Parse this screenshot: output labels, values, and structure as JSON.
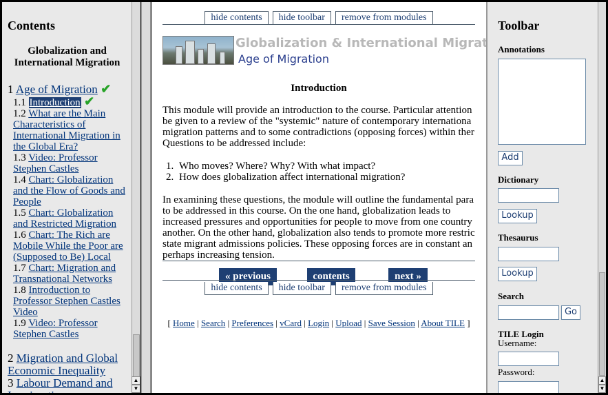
{
  "contents": {
    "heading": "Contents",
    "course_title": "Globalization and International Migration",
    "items": [
      {
        "num": "1",
        "label": "Age of Migration",
        "done": true
      },
      {
        "num": "1.1",
        "label": "Introduction",
        "current": true,
        "done": true
      },
      {
        "num": "1.2",
        "label": "What are the Main Characteristics of International Migration in the Global Era?"
      },
      {
        "num": "1.3",
        "label": "Video: Professor Stephen Castles"
      },
      {
        "num": "1.4",
        "label": "Chart: Globalization and the Flow of Goods and People"
      },
      {
        "num": "1.5",
        "label": "Chart: Globalization and Restricted Migration"
      },
      {
        "num": "1.6",
        "label": "Chart: The Rich are Mobile While the Poor are (Supposed to Be) Local"
      },
      {
        "num": "1.7",
        "label": "Chart: Migration and Transnational Networks"
      },
      {
        "num": "1.8",
        "label": "Introduction to Professor Stephen Castles Video"
      },
      {
        "num": "1.9",
        "label": "Video: Professor Stephen Castles"
      },
      {
        "num": "2",
        "label": "Migration and Global Economic Inequality"
      },
      {
        "num": "3",
        "label": "Labour Demand and Immigration"
      }
    ],
    "check_glyph": "✔"
  },
  "center": {
    "top_buttons": {
      "hide_contents": "hide contents",
      "hide_toolbar": "hide toolbar",
      "remove": "remove from modules"
    },
    "banner_title": "Globalization & International Migrat",
    "banner_subtitle": "Age of Migration",
    "page_heading": "Introduction",
    "para1": [
      "This module will provide an introduction to the course. Particular attention",
      "be given to a review of the \"systemic\" nature of contemporary internationa",
      "migration patterns and to some contradictions (opposing forces) within ther",
      "Questions to be addressed include:"
    ],
    "questions": [
      "Who moves? Where? Why? With what impact?",
      "How does globalization affect international migration?"
    ],
    "para2": [
      "In examining these questions, the module will outline the fundamental para",
      "to be addressed in this course. On the one hand, globalization leads to",
      "increased pressures and opportunities for people to move from one country",
      "another. On the other hand, globalization also tends to promote more restric",
      "state migrant admissions policies. These opposing forces are in constant an",
      "perhaps increasing tension."
    ],
    "nav": {
      "previous": "« previous",
      "contents": "contents",
      "next": "next »"
    },
    "footer_links": [
      "Home",
      "Search",
      "Preferences",
      "vCard",
      "Login",
      "Upload",
      "Save Session",
      "About TILE"
    ]
  },
  "toolbar": {
    "heading": "Toolbar",
    "annotations_label": "Annotations",
    "add_button": "Add",
    "dictionary_label": "Dictionary",
    "lookup_button": "Lookup",
    "thesaurus_label": "Thesaurus",
    "search_label": "Search",
    "go_button": "Go",
    "login_label": "TILE Login",
    "username_label": "Username:",
    "password_label": "Password:"
  }
}
